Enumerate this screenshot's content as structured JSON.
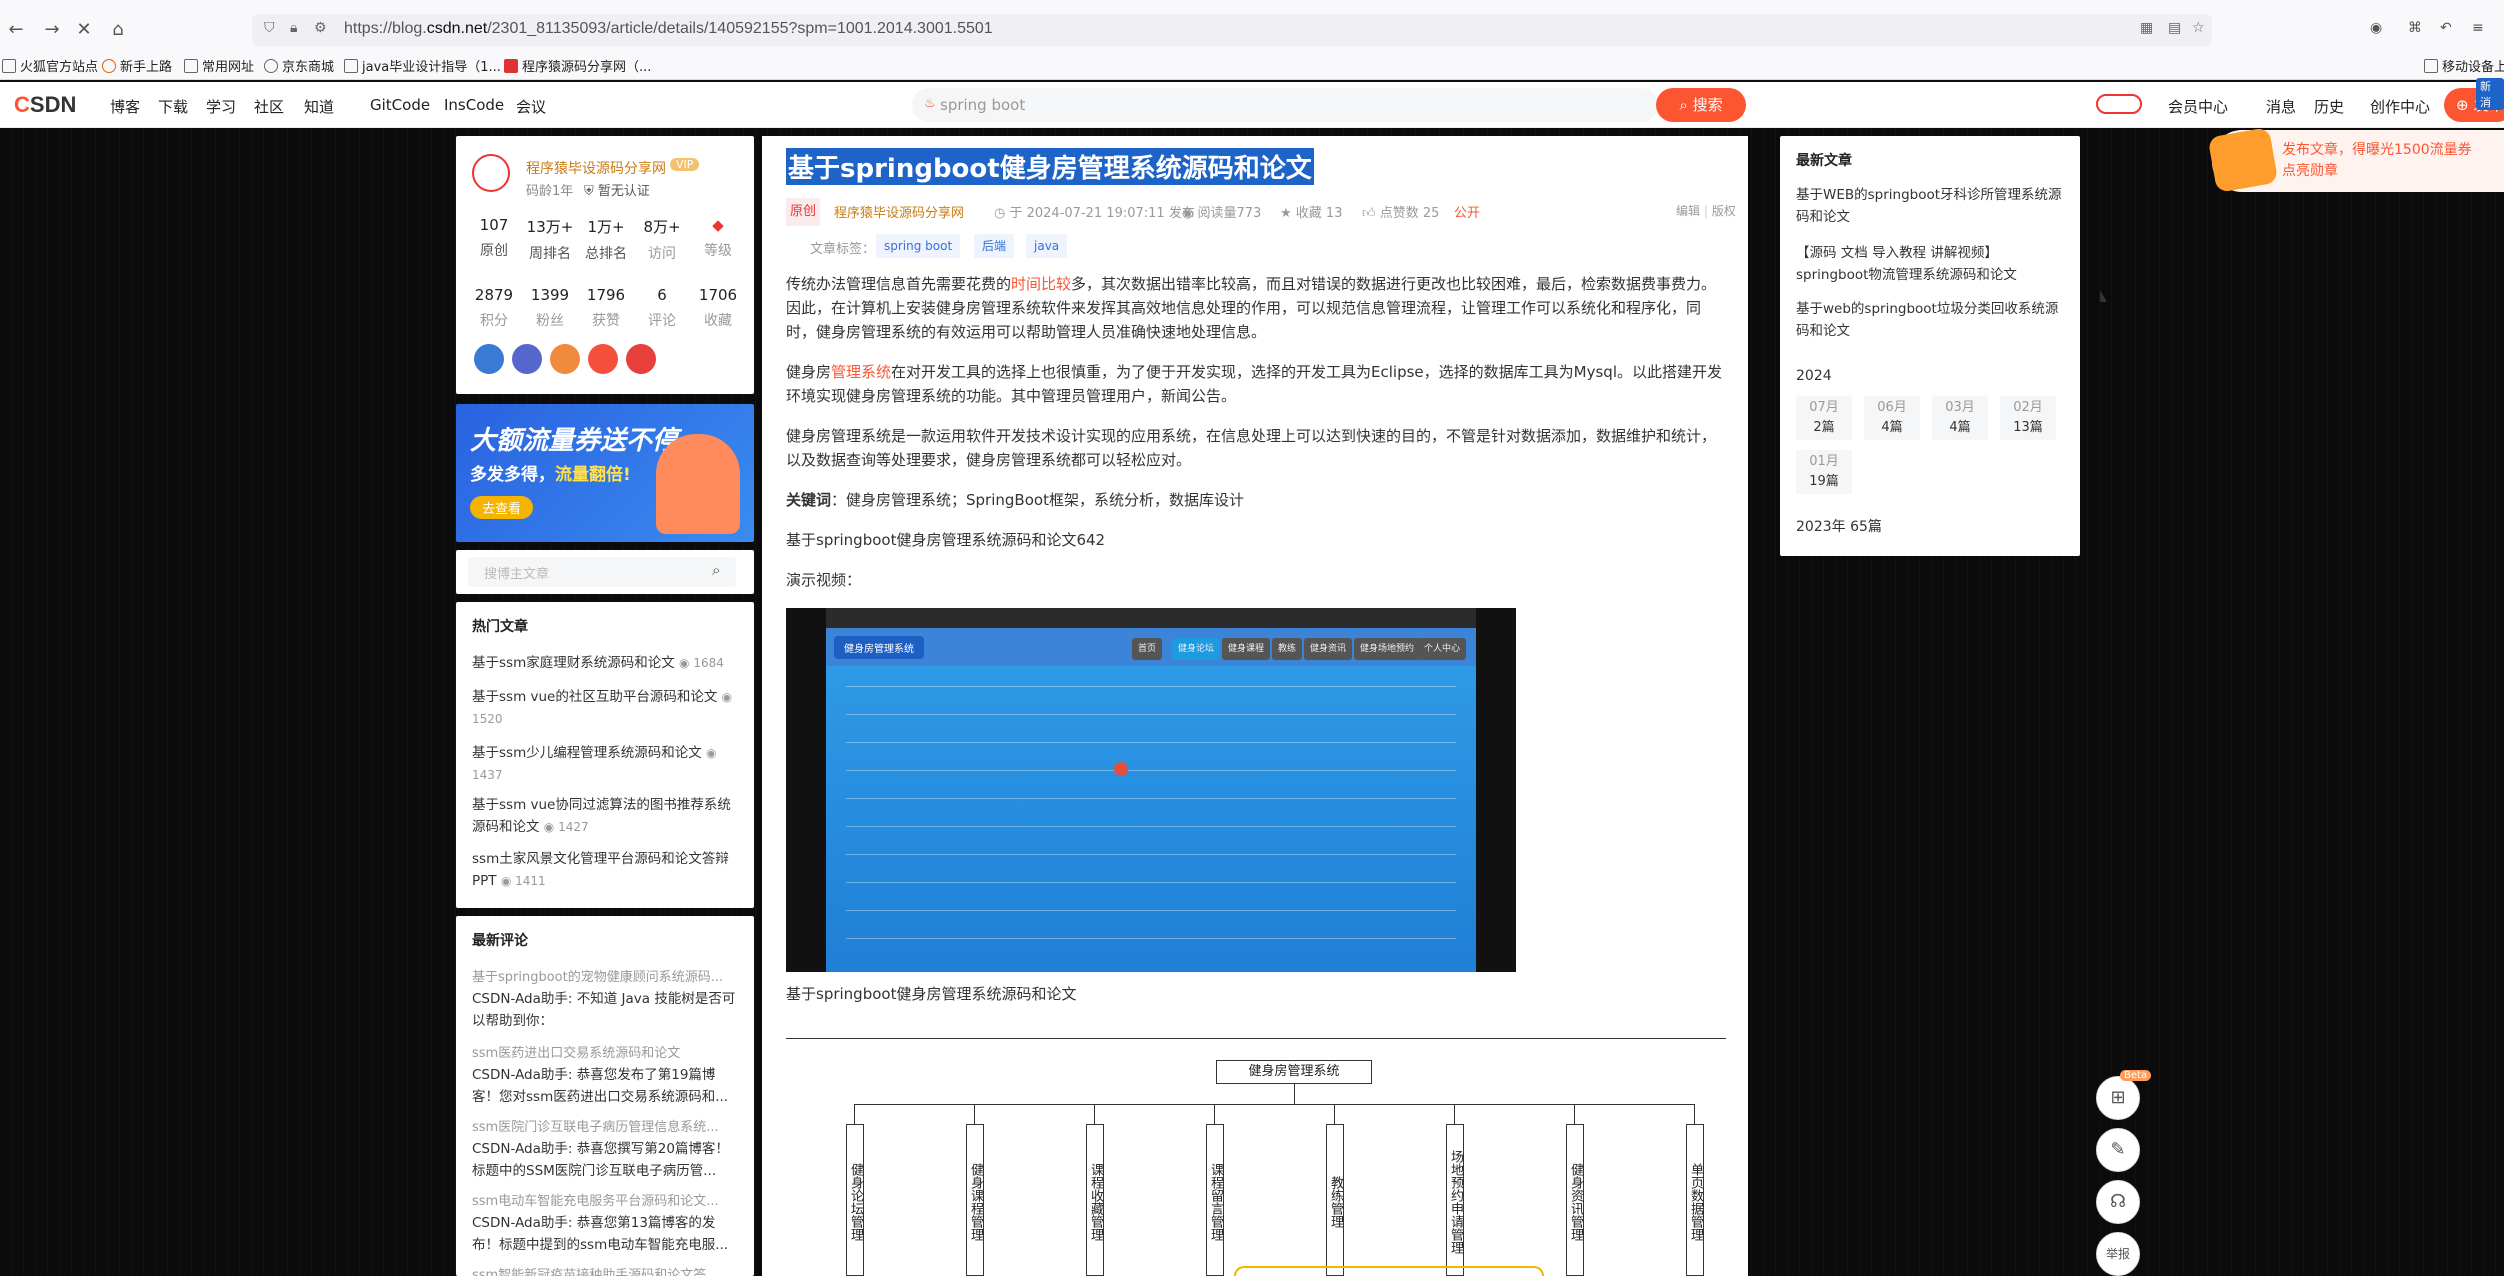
{
  "browser": {
    "url_prefix": "https://blog.",
    "url_domain": "csdn.net",
    "url_rest": "/2301_81135093/article/details/140592155?spm=1001.2014.3001.5501",
    "bookmarks": [
      "火狐官方站点",
      "新手上路",
      "常用网址",
      "京东商城",
      "java毕业设计指导（1...",
      "程序猿源码分享网（...",
      "移动设备上"
    ]
  },
  "header": {
    "logo_left": "C",
    "logo_right": "SDN",
    "nav": [
      "博客",
      "下载",
      "学习",
      "社区",
      "知道",
      "GitCode",
      "InsCode",
      "会议"
    ],
    "search_placeholder": "spring boot",
    "search_button": "搜索",
    "right_nav": [
      "会员中心",
      "消息",
      "历史",
      "创作中心"
    ],
    "publish": "发布",
    "new_badge": "新消"
  },
  "profile": {
    "name": "程序猿毕设源码分享网",
    "vip": "VIP",
    "years": "码龄1年",
    "cert": "暂无认证",
    "stats_row1": [
      {
        "value": "107",
        "label": "原创"
      },
      {
        "value": "13万+",
        "label": "周排名"
      },
      {
        "value": "1万+",
        "label": "总排名"
      },
      {
        "value": "8万+",
        "label": "访问"
      },
      {
        "value": "",
        "label": "等级"
      }
    ],
    "stats_row2": [
      {
        "value": "2879",
        "label": "积分"
      },
      {
        "value": "1399",
        "label": "粉丝"
      },
      {
        "value": "1796",
        "label": "获赞"
      },
      {
        "value": "6",
        "label": "评论"
      },
      {
        "value": "1706",
        "label": "收藏"
      }
    ]
  },
  "ad": {
    "line1": "大额流量券送不停",
    "line2a": "多发多得，",
    "line2b": "流量翻倍!",
    "button": "去查看"
  },
  "side_search": {
    "placeholder": "搜博主文章"
  },
  "hot_articles": {
    "title": "热门文章",
    "items": [
      {
        "text": "基于ssm家庭理财系统源码和论文",
        "count": "1684"
      },
      {
        "text": "基于ssm vue的社区互助平台源码和论文",
        "count": "1520"
      },
      {
        "text": "基于ssm少儿编程管理系统源码和论文",
        "count": "1437"
      },
      {
        "text": "基于ssm vue协同过滤算法的图书推荐系统源码和论文",
        "count": "1427"
      },
      {
        "text": "ssm土家风景文化管理平台源码和论文答辩PPT",
        "count": "1411"
      }
    ]
  },
  "recent_comments": {
    "title": "最新评论",
    "items": [
      {
        "title": "基于springboot的宠物健康顾问系统源码...",
        "text": "CSDN-Ada助手: 不知道 Java 技能树是否可以帮助到你：https://edu.csdn.net/skill/java..."
      },
      {
        "title": "ssm医药进出口交易系统源码和论文",
        "text": "CSDN-Ada助手: 恭喜您发布了第19篇博客！您对ssm医药进出口交易系统源码和..."
      },
      {
        "title": "ssm医院门诊互联电子病历管理信息系统...",
        "text": "CSDN-Ada助手: 恭喜您撰写第20篇博客！标题中的SSM医院门诊互联电子病历管..."
      },
      {
        "title": "ssm电动车智能充电服务平台源码和论文...",
        "text": "CSDN-Ada助手: 恭喜您第13篇博客的发布！标题中提到的ssm电动车智能充电服..."
      },
      {
        "title": "ssm智能新冠疫苗接种助手源码和论文答...",
        "text": ""
      }
    ]
  },
  "article": {
    "title": "基于springboot健身房管理系统源码和论文",
    "original": "原创",
    "author": "程序猿毕设源码分享网",
    "date": "于 2024-07-21 19:07:11 发布",
    "reads": "阅读量773",
    "favorites": "收藏 13",
    "likes": "点赞数 25",
    "visibility": "公开",
    "edit": "编辑",
    "copyright": "版权",
    "tags_label": "文章标签：",
    "tags": [
      "spring boot",
      "后端",
      "java"
    ],
    "p1_a": "传统办法管理信息首先需要花费的",
    "p1_link": "时间比较",
    "p1_b": "多，其次数据出错率比较高，而且对错误的数据进行更改也比较困难，最后，检索数据费事费力。因此，在计算机上安装健身房管理系统软件来发挥其高效地信息处理的作用，可以规范信息管理流程，让管理工作可以系统化和程序化，同时，健身房管理系统的有效运用可以帮助管理人员准确快速地处理信息。",
    "p2_a": "健身房",
    "p2_link": "管理系统",
    "p2_b": "在对开发工具的选择上也很慎重，为了便于开发实现，选择的开发工具为Eclipse，选择的数据库工具为Mysql。以此搭建开发环境实现健身房管理系统的功能。其中管理员管理用户，新闻公告。",
    "p3": "健身房管理系统是一款运用软件开发技术设计实现的应用系统，在信息处理上可以达到快速的目的，不管是针对数据添加，数据维护和统计，以及数据查询等处理要求，健身房管理系统都可以轻松应对。",
    "kw_label": "关键词",
    "kw_text": "：健身房管理系统；SpringBoot框架，系统分析，数据库设计",
    "p5": "基于springboot健身房管理系统源码和论文642",
    "p6": "演示视频：",
    "caption": "基于springboot健身房管理系统源码和论文",
    "video": {
      "brand": "健身房管理系统",
      "tabs": [
        "首页",
        "健身论坛",
        "健身课程",
        "教练",
        "健身资讯",
        "健身场地预约",
        "个人中心"
      ]
    },
    "diagram": {
      "root": "健身房管理系统",
      "nodes": [
        "健身论坛管理",
        "健身课程管理",
        "课程收藏管理",
        "课程留言管理",
        "教练管理",
        "场地预约申请管理",
        "健身资讯管理",
        "单页数据管理"
      ]
    }
  },
  "recent_articles": {
    "title": "最新文章",
    "items": [
      "基于WEB的springboot牙科诊所管理系统源码和论文",
      "【源码 文档 导入教程 讲解视频】springboot物流管理系统源码和论文",
      "基于web的springboot垃圾分类回收系统源码和论文"
    ],
    "year": "2024",
    "months": [
      {
        "m": "07月",
        "c": "2篇"
      },
      {
        "m": "06月",
        "c": "4篇"
      },
      {
        "m": "03月",
        "c": "4篇"
      },
      {
        "m": "02月",
        "c": "13篇"
      },
      {
        "m": "01月",
        "c": "19篇"
      }
    ],
    "year2023": "2023年  65篇"
  },
  "promo": {
    "line1": "发布文章，得曝光1500流量券",
    "line2": "点亮勋章"
  },
  "tools": {
    "beta": "Beta",
    "report": "举报"
  }
}
